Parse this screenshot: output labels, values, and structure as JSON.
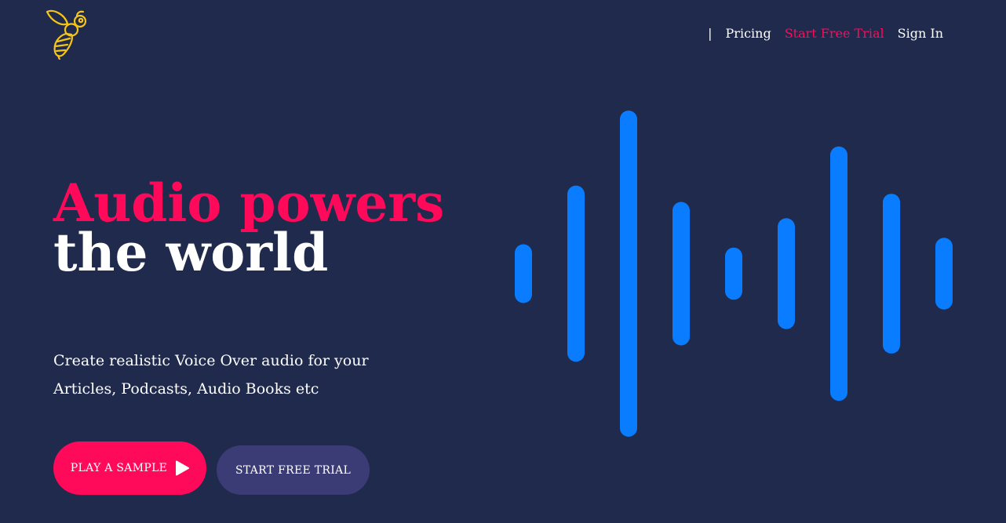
{
  "brand": {
    "logo_icon": "bee-icon",
    "logo_color": "#f5c518"
  },
  "nav": {
    "separator": "|",
    "pricing": "Pricing",
    "trial": "Start Free Trial",
    "signin": "Sign In"
  },
  "hero": {
    "headline_accent": "Audio powers",
    "headline_rest": "the world",
    "subtitle": "Create realistic Voice Over audio for your Articles, Podcasts, Audio Books etc",
    "play_button": "PLAY A SAMPLE",
    "trial_button": "START FREE TRIAL"
  },
  "colors": {
    "background": "#1f2a4d",
    "accent": "#ff0a5a",
    "wave": "#0a7cff",
    "secondary_button": "#3b3b75"
  },
  "waveform": {
    "icon": "audio-waveform",
    "levels": [
      0.18,
      0.54,
      1.0,
      0.44,
      0.16,
      0.34,
      0.78,
      0.49,
      0.22
    ]
  }
}
